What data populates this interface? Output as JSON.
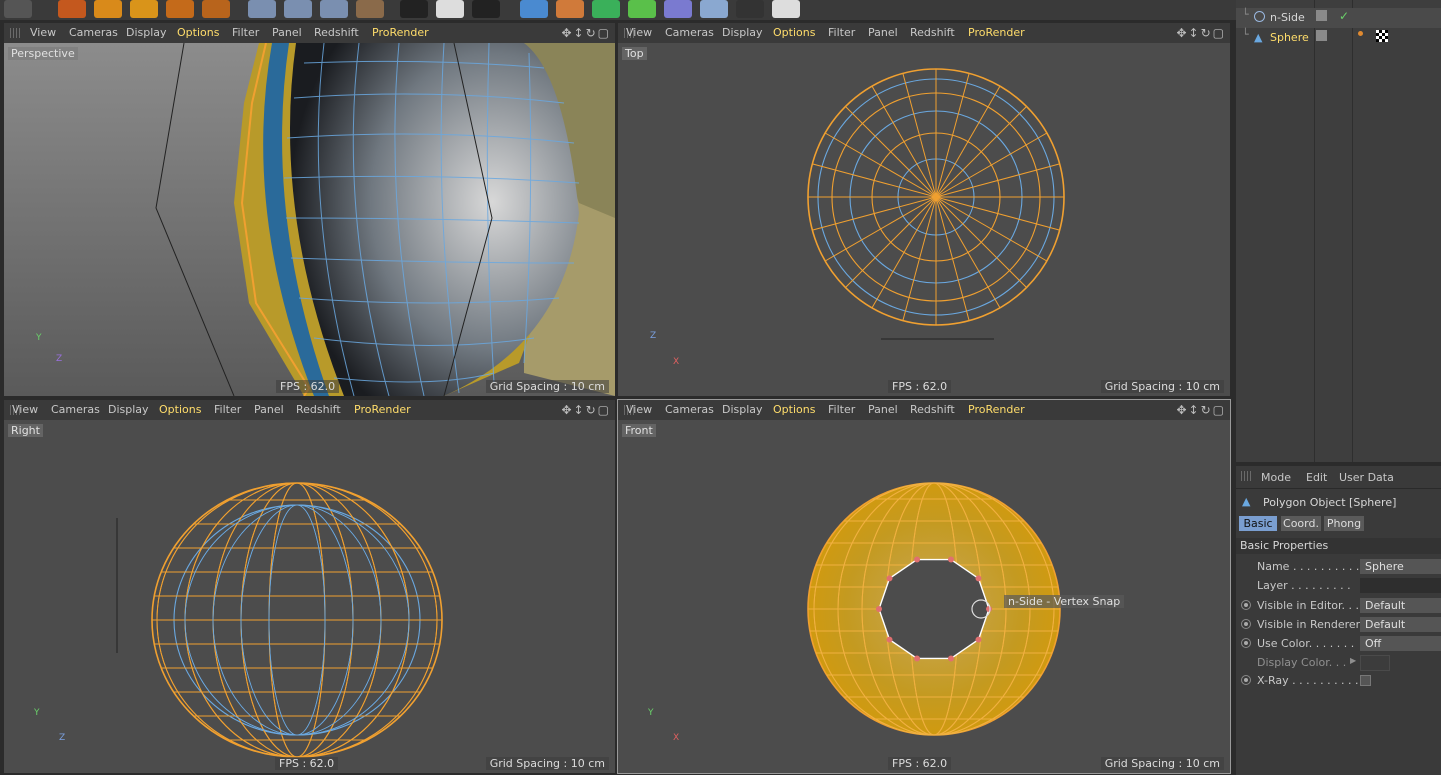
{
  "colors": {
    "accent": "#ffdd6b",
    "wire_orange": "#f0a030",
    "wire_blue": "#6aa8e0",
    "viewport_bg": "#4c4c4c"
  },
  "viewports": {
    "menu": [
      "View",
      "Cameras",
      "Display",
      "Options",
      "Filter",
      "Panel",
      "Redshift",
      "ProRender"
    ],
    "perspective": {
      "label": "Perspective",
      "fps": "FPS : 62.0",
      "grid": "Grid Spacing : 10 cm"
    },
    "top": {
      "label": "Top",
      "fps": "FPS : 62.0",
      "grid": "Grid Spacing : 10 cm"
    },
    "right": {
      "label": "Right",
      "fps": "FPS : 62.0",
      "grid": "Grid Spacing : 10 cm"
    },
    "front": {
      "label": "Front",
      "fps": "FPS : 62.0",
      "grid": "Grid Spacing : 10 cm",
      "tooltip": "n-Side - Vertex Snap"
    }
  },
  "axes": {
    "y": "Y",
    "z": "Z",
    "x": "X"
  },
  "object_manager": {
    "objects": [
      {
        "name": "n-Side",
        "icon": "circle-spline-icon"
      },
      {
        "name": "Sphere",
        "icon": "polygon-object-icon"
      }
    ]
  },
  "attribute_manager": {
    "menu": [
      "Mode",
      "Edit",
      "User Data"
    ],
    "title": "Polygon Object [Sphere]",
    "tabs": [
      "Basic",
      "Coord.",
      "Phong"
    ],
    "section": "Basic Properties",
    "fields": [
      {
        "label": "Name . . . . . . . . . .",
        "value": "Sphere"
      },
      {
        "label": "Layer . . . . . . . . .",
        "value": ""
      },
      {
        "label": "Visible in Editor. . .",
        "value": "Default"
      },
      {
        "label": "Visible in Renderer",
        "value": "Default"
      },
      {
        "label": "Use Color. . . . . . .",
        "value": "Off"
      },
      {
        "label": "Display Color. . .",
        "value": ""
      },
      {
        "label": "X-Ray . . . . . . . . . .",
        "value": ""
      }
    ]
  }
}
